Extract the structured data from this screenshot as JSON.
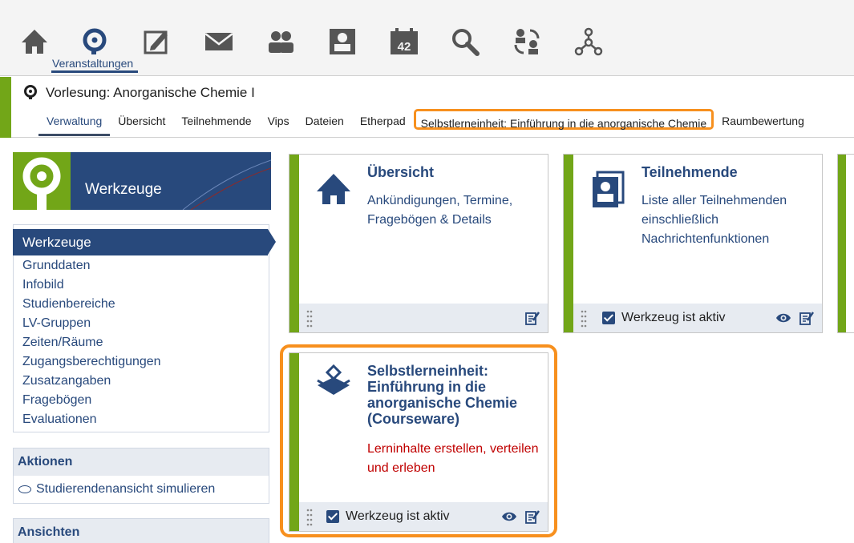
{
  "nav": {
    "active_label": "Veranstaltungen",
    "icons": [
      "home-icon",
      "courses-icon",
      "edit-icon",
      "mail-icon",
      "community-icon",
      "profile-icon",
      "calendar-icon",
      "search-icon",
      "sync-icon",
      "network-icon"
    ],
    "calendar_number": "42"
  },
  "context": {
    "title": "Vorlesung: Anorganische Chemie I",
    "tabs": [
      {
        "label": "Verwaltung"
      },
      {
        "label": "Übersicht"
      },
      {
        "label": "Teilnehmende"
      },
      {
        "label": "Vips"
      },
      {
        "label": "Dateien"
      },
      {
        "label": "Etherpad"
      },
      {
        "label": "Selbstlerneinheit: Einführung in die anorganische Chemie"
      },
      {
        "label": "Raumbewertung"
      }
    ]
  },
  "sidebar": {
    "header_title": "Werkzeuge",
    "active_item": "Werkzeuge",
    "items": [
      "Grunddaten",
      "Infobild",
      "Studienbereiche",
      "LV-Gruppen",
      "Zeiten/Räume",
      "Zugangsberechtigungen",
      "Zusatzangaben",
      "Fragebögen",
      "Evaluationen"
    ],
    "actions_title": "Aktionen",
    "actions_item": "Studierendenansicht simulieren",
    "views_title": "Ansichten"
  },
  "tiles": [
    {
      "title": "Übersicht",
      "desc": "Ankündigungen, Termine, Fragebögen & Details"
    },
    {
      "title": "Teilnehmende",
      "desc": "Liste aller Teilnehmenden einschließlich Nachrichtenfunktionen",
      "status": "Werkzeug ist aktiv"
    },
    {
      "title": "Selbstlerneinheit: Einführung in die anorganische Chemie (Courseware)",
      "desc": "Lerninhalte erstellen, verteilen und erleben",
      "status": "Werkzeug ist aktiv"
    }
  ],
  "colors": {
    "brand_blue": "#28497c",
    "accent_green": "#72a618",
    "highlight_orange": "#f7901e",
    "courseware_red": "#c00000"
  }
}
